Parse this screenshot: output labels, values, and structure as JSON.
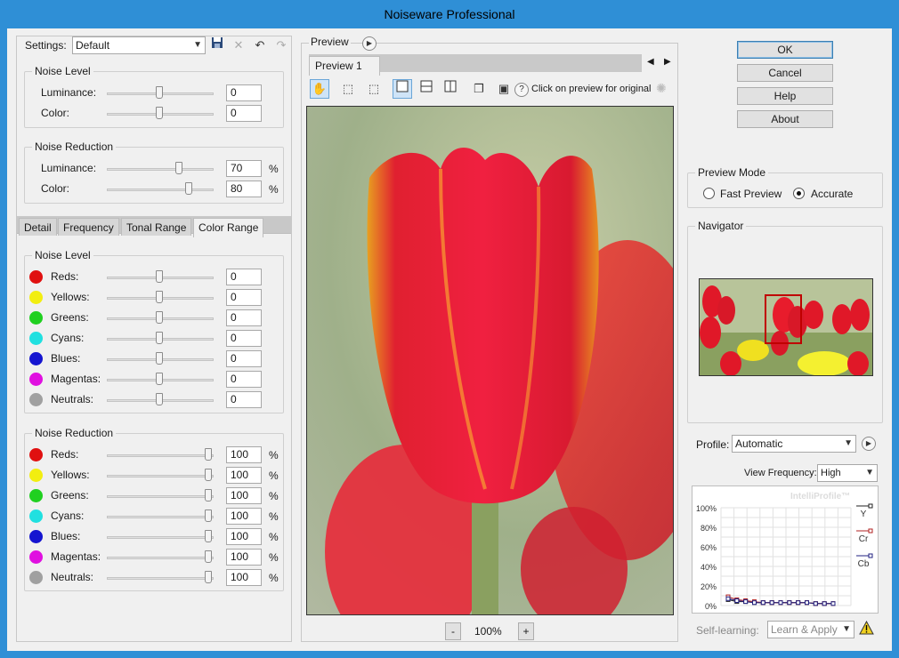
{
  "window": {
    "title": "Noiseware Professional"
  },
  "settings": {
    "label": "Settings:",
    "value": "Default"
  },
  "noise_level": {
    "title": "Noise Level",
    "luminance_label": "Luminance:",
    "luminance_value": "0",
    "color_label": "Color:",
    "color_value": "0"
  },
  "noise_reduction": {
    "title": "Noise Reduction",
    "luminance_label": "Luminance:",
    "luminance_value": "70",
    "color_label": "Color:",
    "color_value": "80",
    "unit": "%"
  },
  "tabs": [
    "Detail",
    "Frequency",
    "Tonal Range",
    "Color Range"
  ],
  "color_range": {
    "noise_level_title": "Noise Level",
    "noise_reduction_title": "Noise Reduction",
    "colors": [
      {
        "label": "Reds:",
        "swatch": "#e01010",
        "level": "0",
        "reduction": "100"
      },
      {
        "label": "Yellows:",
        "swatch": "#f2ee10",
        "level": "0",
        "reduction": "100"
      },
      {
        "label": "Greens:",
        "swatch": "#20d020",
        "level": "0",
        "reduction": "100"
      },
      {
        "label": "Cyans:",
        "swatch": "#20e0e0",
        "level": "0",
        "reduction": "100"
      },
      {
        "label": "Blues:",
        "swatch": "#1515d0",
        "level": "0",
        "reduction": "100"
      },
      {
        "label": "Magentas:",
        "swatch": "#e010e0",
        "level": "0",
        "reduction": "100"
      },
      {
        "label": "Neutrals:",
        "swatch": "#a0a0a0",
        "level": "0",
        "reduction": "100"
      }
    ],
    "unit": "%"
  },
  "preview": {
    "title": "Preview",
    "tab": "Preview 1",
    "hint": "Click on preview for original",
    "zoom": "100%",
    "zoom_minus": "-",
    "zoom_plus": "+"
  },
  "buttons": {
    "ok": "OK",
    "cancel": "Cancel",
    "help": "Help",
    "about": "About"
  },
  "preview_mode": {
    "title": "Preview Mode",
    "fast": "Fast Preview",
    "accurate": "Accurate",
    "selected": "accurate"
  },
  "navigator": {
    "title": "Navigator"
  },
  "profile": {
    "label": "Profile:",
    "value": "Automatic",
    "view_freq_label": "View Frequency:",
    "view_freq_value": "High",
    "graph_watermark": "IntelliProfile™",
    "y_ticks": [
      "100%",
      "80%",
      "60%",
      "40%",
      "20%",
      "0%"
    ],
    "legend": [
      {
        "name": "Y",
        "color": "#222222"
      },
      {
        "name": "Cr",
        "color": "#b02020"
      },
      {
        "name": "Cb",
        "color": "#202080"
      }
    ],
    "self_learning_label": "Self-learning:",
    "learn_apply": "Learn & Apply"
  },
  "chart_data": {
    "type": "line",
    "ylim": [
      0,
      100
    ],
    "y_ticks": [
      "100%",
      "80%",
      "60%",
      "40%",
      "20%",
      "0%"
    ],
    "series": [
      {
        "name": "Y",
        "values": [
          6,
          4,
          4,
          3,
          3,
          3,
          3,
          3,
          3,
          3,
          2,
          2,
          2
        ]
      },
      {
        "name": "Cr",
        "values": [
          9,
          6,
          5,
          4,
          3,
          3,
          3,
          3,
          3,
          3,
          2,
          2,
          2
        ]
      },
      {
        "name": "Cb",
        "values": [
          7,
          5,
          4,
          3,
          3,
          3,
          3,
          3,
          3,
          3,
          2,
          2,
          2
        ]
      }
    ]
  }
}
